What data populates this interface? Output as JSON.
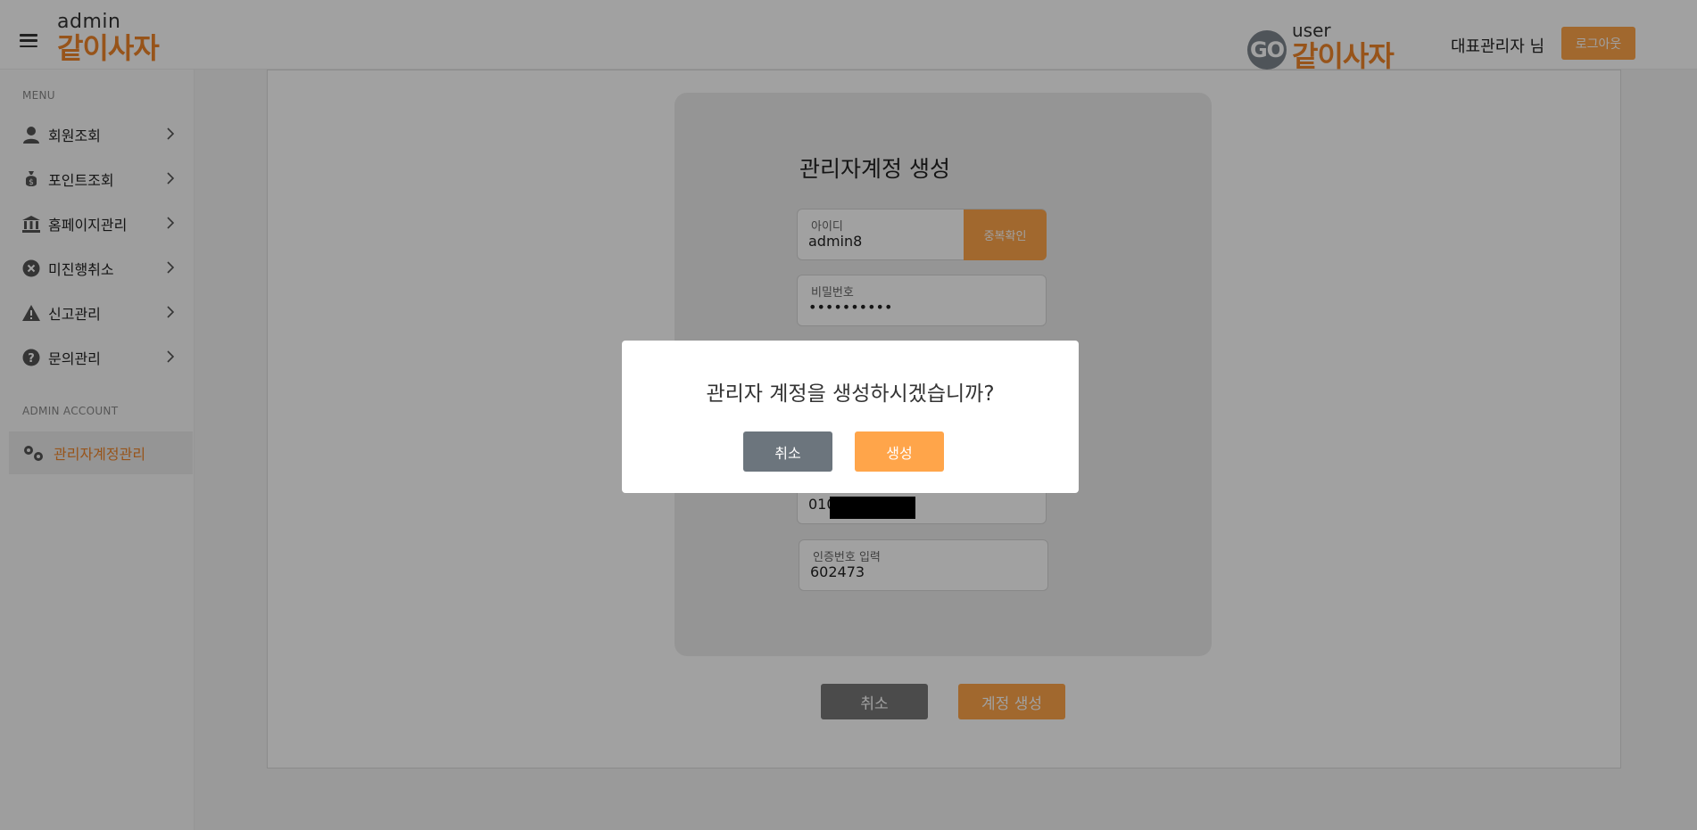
{
  "header": {
    "admin_logo_sub": "admin",
    "admin_logo_brand": "같이사자",
    "user_logo_go": "GO",
    "user_logo_sub": "user",
    "user_logo_brand": "같이사자",
    "username": "대표관리자 님",
    "logout_label": "로그아웃"
  },
  "sidebar": {
    "menu_label": "MENU",
    "items": [
      {
        "label": "회원조회",
        "icon": "person-icon"
      },
      {
        "label": "포인트조회",
        "icon": "money-bag-icon"
      },
      {
        "label": "홈페이지관리",
        "icon": "bank-icon"
      },
      {
        "label": "미진행취소",
        "icon": "x-circle-icon"
      },
      {
        "label": "신고관리",
        "icon": "warning-icon"
      },
      {
        "label": "문의관리",
        "icon": "question-circle-icon"
      }
    ],
    "admin_account_label": "ADMIN ACCOUNT",
    "admin_items": [
      {
        "label": "관리자계정관리",
        "icon": "gears-icon",
        "active": true
      }
    ]
  },
  "form": {
    "title": "관리자계정 생성",
    "id_label": "아이디",
    "id_value": "admin8",
    "dup_check_label": "중복확인",
    "password_label": "비밀번호",
    "password_value": "••••••••••",
    "phone_value": "010",
    "auth_label": "인증번호 입력",
    "auth_value": "602473",
    "cancel_label": "취소",
    "create_label": "계정 생성"
  },
  "modal": {
    "message": "관리자 계정을 생성하시겠습니까?",
    "cancel_label": "취소",
    "confirm_label": "생성"
  },
  "colors": {
    "accent": "#ffa54a",
    "brand": "#f0852a",
    "gray_button": "#6c757d"
  }
}
